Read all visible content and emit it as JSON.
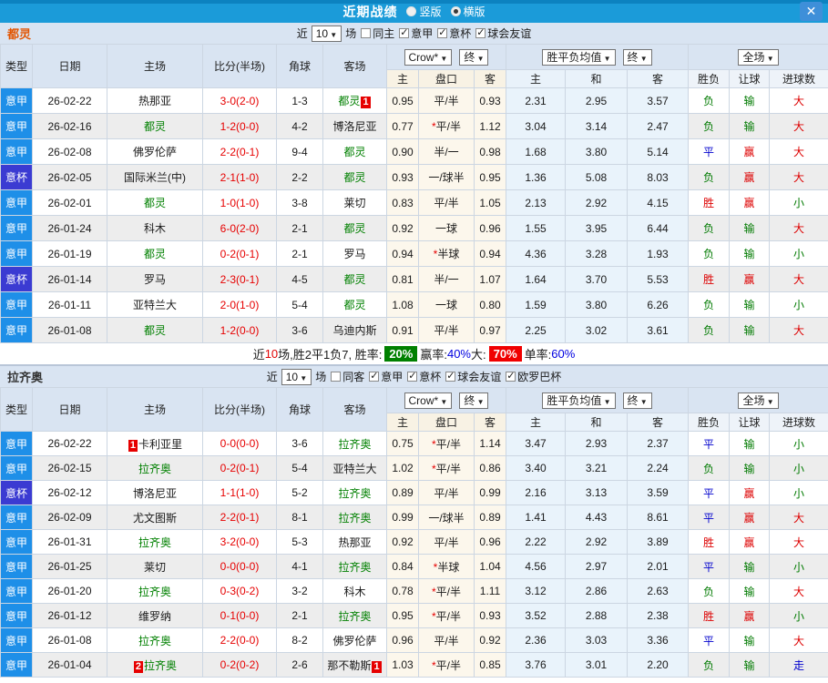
{
  "titlebar": {
    "title": "近期战绩",
    "radios": [
      {
        "label": "竖版",
        "checked": false
      },
      {
        "label": "横版",
        "checked": true
      }
    ],
    "close": "✕"
  },
  "table": {
    "main_headers": [
      "类型",
      "日期",
      "主场",
      "比分(半场)",
      "角球",
      "客场"
    ],
    "sub_headers": [
      "主",
      "盘口",
      "客",
      "主",
      "和",
      "客",
      "胜负",
      "让球",
      "进球数"
    ],
    "dropdowns": {
      "bookmaker": "Crow*",
      "final1": "终",
      "avg": "胜平负均值",
      "final2": "终",
      "scope": "全场"
    }
  },
  "colors": {
    "league_bg": "#1e8fe8",
    "cup_bg": "#3b3bd2",
    "self_team": "#008000",
    "score_red": "#e60000",
    "win_red": "#dd0000",
    "lose_green": "#007a00",
    "draw_blue": "#0000cd",
    "header_blue": "#1b9bd9",
    "panel_bg": "#d9e4f2"
  },
  "sections": [
    {
      "team": "都灵",
      "filter": {
        "near_label": "近",
        "count": "10",
        "games_label": "场",
        "checkboxes": [
          {
            "label": "同主",
            "checked": false
          },
          {
            "label": "意甲",
            "checked": true
          },
          {
            "label": "意杯",
            "checked": true
          },
          {
            "label": "球会友谊",
            "checked": true
          }
        ]
      },
      "rows": [
        {
          "type": "意甲",
          "date": "26-02-22",
          "home": {
            "name": "热那亚",
            "self": false
          },
          "score": "3-0(2-0)",
          "corners": "1-3",
          "away": {
            "name": "都灵",
            "self": true,
            "badge": "1",
            "badge_pos": "after"
          },
          "odds": [
            "0.95",
            "平/半",
            "0.93"
          ],
          "means": [
            "2.31",
            "2.95",
            "3.57"
          ],
          "results": [
            "负",
            "输",
            "大"
          ]
        },
        {
          "type": "意甲",
          "date": "26-02-16",
          "home": {
            "name": "都灵",
            "self": true
          },
          "score": "1-2(0-0)",
          "corners": "4-2",
          "away": {
            "name": "博洛尼亚",
            "self": false
          },
          "odds": [
            "0.77",
            "*平/半",
            "1.12"
          ],
          "means": [
            "3.04",
            "3.14",
            "2.47"
          ],
          "results": [
            "负",
            "输",
            "大"
          ]
        },
        {
          "type": "意甲",
          "date": "26-02-08",
          "home": {
            "name": "佛罗伦萨",
            "self": false
          },
          "score": "2-2(0-1)",
          "corners": "9-4",
          "away": {
            "name": "都灵",
            "self": true
          },
          "odds": [
            "0.90",
            "半/一",
            "0.98"
          ],
          "means": [
            "1.68",
            "3.80",
            "5.14"
          ],
          "results": [
            "平",
            "赢",
            "大"
          ]
        },
        {
          "type": "意杯",
          "date": "26-02-05",
          "home": {
            "name": "国际米兰(中)",
            "self": false
          },
          "score": "2-1(1-0)",
          "corners": "2-2",
          "away": {
            "name": "都灵",
            "self": true
          },
          "odds": [
            "0.93",
            "一/球半",
            "0.95"
          ],
          "means": [
            "1.36",
            "5.08",
            "8.03"
          ],
          "results": [
            "负",
            "赢",
            "大"
          ]
        },
        {
          "type": "意甲",
          "date": "26-02-01",
          "home": {
            "name": "都灵",
            "self": true
          },
          "score": "1-0(1-0)",
          "corners": "3-8",
          "away": {
            "name": "莱切",
            "self": false
          },
          "odds": [
            "0.83",
            "平/半",
            "1.05"
          ],
          "means": [
            "2.13",
            "2.92",
            "4.15"
          ],
          "results": [
            "胜",
            "赢",
            "小"
          ]
        },
        {
          "type": "意甲",
          "date": "26-01-24",
          "home": {
            "name": "科木",
            "self": false
          },
          "score": "6-0(2-0)",
          "corners": "2-1",
          "away": {
            "name": "都灵",
            "self": true
          },
          "odds": [
            "0.92",
            "一球",
            "0.96"
          ],
          "means": [
            "1.55",
            "3.95",
            "6.44"
          ],
          "results": [
            "负",
            "输",
            "大"
          ]
        },
        {
          "type": "意甲",
          "date": "26-01-19",
          "home": {
            "name": "都灵",
            "self": true
          },
          "score": "0-2(0-1)",
          "corners": "2-1",
          "away": {
            "name": "罗马",
            "self": false
          },
          "odds": [
            "0.94",
            "*半球",
            "0.94"
          ],
          "means": [
            "4.36",
            "3.28",
            "1.93"
          ],
          "results": [
            "负",
            "输",
            "小"
          ]
        },
        {
          "type": "意杯",
          "date": "26-01-14",
          "home": {
            "name": "罗马",
            "self": false
          },
          "score": "2-3(0-1)",
          "corners": "4-5",
          "away": {
            "name": "都灵",
            "self": true
          },
          "odds": [
            "0.81",
            "半/一",
            "1.07"
          ],
          "means": [
            "1.64",
            "3.70",
            "5.53"
          ],
          "results": [
            "胜",
            "赢",
            "大"
          ]
        },
        {
          "type": "意甲",
          "date": "26-01-11",
          "home": {
            "name": "亚特兰大",
            "self": false
          },
          "score": "2-0(1-0)",
          "corners": "5-4",
          "away": {
            "name": "都灵",
            "self": true
          },
          "odds": [
            "1.08",
            "一球",
            "0.80"
          ],
          "means": [
            "1.59",
            "3.80",
            "6.26"
          ],
          "results": [
            "负",
            "输",
            "小"
          ]
        },
        {
          "type": "意甲",
          "date": "26-01-08",
          "home": {
            "name": "都灵",
            "self": true
          },
          "score": "1-2(0-0)",
          "corners": "3-6",
          "away": {
            "name": "乌迪内斯",
            "self": false
          },
          "odds": [
            "0.91",
            "平/半",
            "0.97"
          ],
          "means": [
            "2.25",
            "3.02",
            "3.61"
          ],
          "results": [
            "负",
            "输",
            "大"
          ]
        }
      ],
      "summary_parts": [
        {
          "t": "近",
          "s": "plain"
        },
        {
          "t": "10",
          "s": "red"
        },
        {
          "t": "场,胜2平1负7, 胜率:",
          "s": "plain"
        },
        {
          "t": "20%",
          "s": "badge-green"
        },
        {
          "t": " 赢率:",
          "s": "plain"
        },
        {
          "t": "40%",
          "s": "blue"
        },
        {
          "t": " 大:",
          "s": "plain"
        },
        {
          "t": "70%",
          "s": "badge-red"
        },
        {
          "t": " 单率:",
          "s": "plain"
        },
        {
          "t": "60%",
          "s": "blue"
        }
      ]
    },
    {
      "team": "拉齐奥",
      "filter": {
        "near_label": "近",
        "count": "10",
        "games_label": "场",
        "checkboxes": [
          {
            "label": "同客",
            "checked": false
          },
          {
            "label": "意甲",
            "checked": true
          },
          {
            "label": "意杯",
            "checked": true
          },
          {
            "label": "球会友谊",
            "checked": true
          },
          {
            "label": "欧罗巴杯",
            "checked": true
          }
        ]
      },
      "rows": [
        {
          "type": "意甲",
          "date": "26-02-22",
          "home": {
            "name": "卡利亚里",
            "self": false,
            "badge": "1",
            "badge_pos": "before"
          },
          "score": "0-0(0-0)",
          "corners": "3-6",
          "away": {
            "name": "拉齐奥",
            "self": true
          },
          "odds": [
            "0.75",
            "*平/半",
            "1.14"
          ],
          "means": [
            "3.47",
            "2.93",
            "2.37"
          ],
          "results": [
            "平",
            "输",
            "小"
          ]
        },
        {
          "type": "意甲",
          "date": "26-02-15",
          "home": {
            "name": "拉齐奥",
            "self": true
          },
          "score": "0-2(0-1)",
          "corners": "5-4",
          "away": {
            "name": "亚特兰大",
            "self": false
          },
          "odds": [
            "1.02",
            "*平/半",
            "0.86"
          ],
          "means": [
            "3.40",
            "3.21",
            "2.24"
          ],
          "results": [
            "负",
            "输",
            "小"
          ]
        },
        {
          "type": "意杯",
          "date": "26-02-12",
          "home": {
            "name": "博洛尼亚",
            "self": false
          },
          "score": "1-1(1-0)",
          "corners": "5-2",
          "away": {
            "name": "拉齐奥",
            "self": true
          },
          "odds": [
            "0.89",
            "平/半",
            "0.99"
          ],
          "means": [
            "2.16",
            "3.13",
            "3.59"
          ],
          "results": [
            "平",
            "赢",
            "小"
          ]
        },
        {
          "type": "意甲",
          "date": "26-02-09",
          "home": {
            "name": "尤文图斯",
            "self": false
          },
          "score": "2-2(0-1)",
          "corners": "8-1",
          "away": {
            "name": "拉齐奥",
            "self": true
          },
          "odds": [
            "0.99",
            "一/球半",
            "0.89"
          ],
          "means": [
            "1.41",
            "4.43",
            "8.61"
          ],
          "results": [
            "平",
            "赢",
            "大"
          ]
        },
        {
          "type": "意甲",
          "date": "26-01-31",
          "home": {
            "name": "拉齐奥",
            "self": true
          },
          "score": "3-2(0-0)",
          "corners": "5-3",
          "away": {
            "name": "热那亚",
            "self": false
          },
          "odds": [
            "0.92",
            "平/半",
            "0.96"
          ],
          "means": [
            "2.22",
            "2.92",
            "3.89"
          ],
          "results": [
            "胜",
            "赢",
            "大"
          ]
        },
        {
          "type": "意甲",
          "date": "26-01-25",
          "home": {
            "name": "莱切",
            "self": false
          },
          "score": "0-0(0-0)",
          "corners": "4-1",
          "away": {
            "name": "拉齐奥",
            "self": true
          },
          "odds": [
            "0.84",
            "*半球",
            "1.04"
          ],
          "means": [
            "4.56",
            "2.97",
            "2.01"
          ],
          "results": [
            "平",
            "输",
            "小"
          ]
        },
        {
          "type": "意甲",
          "date": "26-01-20",
          "home": {
            "name": "拉齐奥",
            "self": true
          },
          "score": "0-3(0-2)",
          "corners": "3-2",
          "away": {
            "name": "科木",
            "self": false
          },
          "odds": [
            "0.78",
            "*平/半",
            "1.11"
          ],
          "means": [
            "3.12",
            "2.86",
            "2.63"
          ],
          "results": [
            "负",
            "输",
            "大"
          ]
        },
        {
          "type": "意甲",
          "date": "26-01-12",
          "home": {
            "name": "维罗纳",
            "self": false
          },
          "score": "0-1(0-0)",
          "corners": "2-1",
          "away": {
            "name": "拉齐奥",
            "self": true
          },
          "odds": [
            "0.95",
            "*平/半",
            "0.93"
          ],
          "means": [
            "3.52",
            "2.88",
            "2.38"
          ],
          "results": [
            "胜",
            "赢",
            "小"
          ]
        },
        {
          "type": "意甲",
          "date": "26-01-08",
          "home": {
            "name": "拉齐奥",
            "self": true
          },
          "score": "2-2(0-0)",
          "corners": "8-2",
          "away": {
            "name": "佛罗伦萨",
            "self": false
          },
          "odds": [
            "0.96",
            "平/半",
            "0.92"
          ],
          "means": [
            "2.36",
            "3.03",
            "3.36"
          ],
          "results": [
            "平",
            "输",
            "大"
          ]
        },
        {
          "type": "意甲",
          "date": "26-01-04",
          "home": {
            "name": "拉齐奥",
            "self": true,
            "badge": "2",
            "badge_pos": "before"
          },
          "score": "0-2(0-2)",
          "corners": "2-6",
          "away": {
            "name": "那不勒斯",
            "self": false,
            "badge": "1",
            "badge_pos": "after"
          },
          "odds": [
            "1.03",
            "*平/半",
            "0.85"
          ],
          "means": [
            "3.76",
            "3.01",
            "2.20"
          ],
          "results": [
            "负",
            "输",
            "走"
          ]
        }
      ],
      "summary_parts": null
    }
  ]
}
